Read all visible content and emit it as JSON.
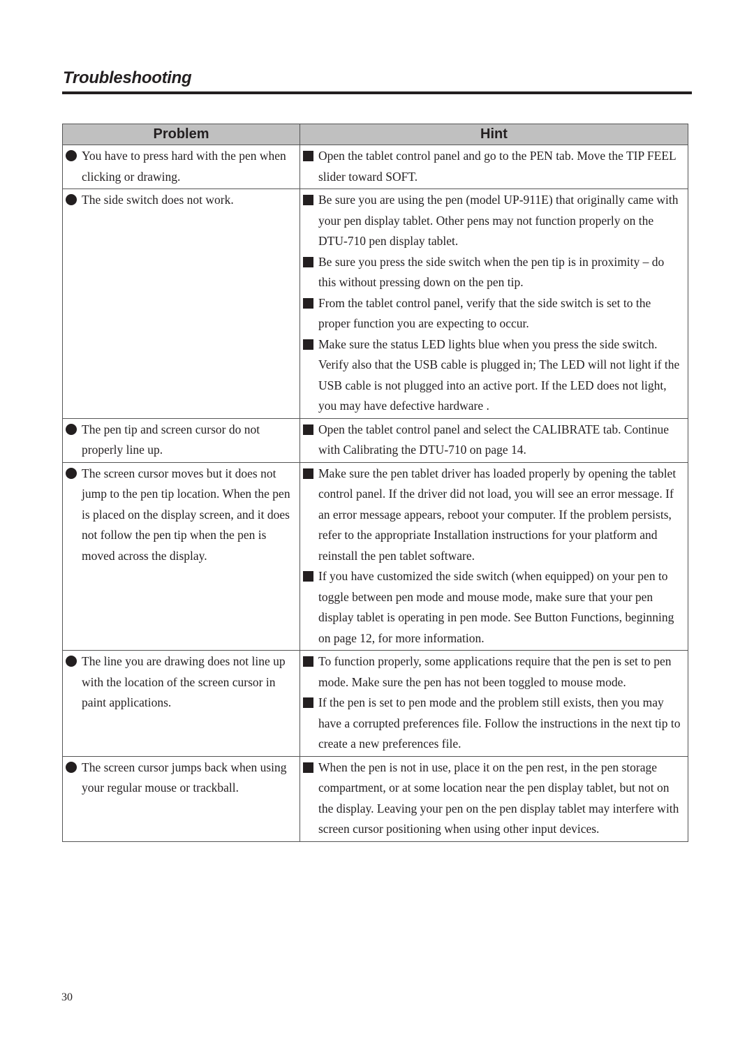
{
  "header": {
    "title": "Troubleshooting"
  },
  "table": {
    "columns": [
      "Problem",
      "Hint"
    ],
    "rows": [
      {
        "problem": "You have to press hard with the pen when clicking or drawing.",
        "hints": [
          "Open the tablet control panel and go to the PEN tab. Move the TIP FEEL slider toward SOFT."
        ]
      },
      {
        "problem": "The side switch does not work.",
        "hints": [
          "Be sure you are using the pen (model UP-911E) that originally came with your pen display tablet. Other pens may not function properly on the DTU-710 pen display tablet.",
          "Be sure you press the side switch when the pen tip is in proximity – do this without pressing down on the pen tip.",
          "From the tablet control panel, verify that the side switch is set to the proper function you are expecting to occur.",
          "Make sure the status LED lights blue when you press the side switch. Verify also that the USB cable is plugged in; The LED will not light if the USB cable is not plugged into an active port. If the LED does not light, you may have defective hardware ."
        ]
      },
      {
        "problem": "The pen tip and screen cursor do not properly line up.",
        "hints": [
          "Open the tablet control panel and select the CALIBRATE tab. Continue with Calibrating the DTU-710 on page 14."
        ]
      },
      {
        "problem": "The screen cursor moves but it does not jump to the pen tip location. When the pen is placed on the display screen, and it does not follow the pen tip when the pen is moved across the display.",
        "hints": [
          "Make sure the pen tablet driver has loaded properly by opening the tablet control panel. If the driver did not load, you will see an error message. If an error message appears, reboot your computer. If the problem persists, refer to the appropriate Installation instructions for your platform and reinstall the pen tablet software.",
          "If you have customized the side switch (when equipped) on your pen to toggle between pen mode and mouse mode, make sure that your pen display tablet is operating in pen mode. See Button Functions, beginning on page 12, for more information."
        ]
      },
      {
        "problem": "The line you are drawing does not line up with the location of the screen cursor in paint applications.",
        "hints": [
          "To function properly, some applications require that the pen is set to pen mode. Make sure the pen has not been toggled to mouse mode.",
          "If the pen is set to pen mode and the problem still exists, then you may have a corrupted preferences file. Follow the instructions in the next tip to create a new preferences file."
        ]
      },
      {
        "problem": "The screen cursor jumps back when using your regular mouse or trackball.",
        "hints": [
          "When the pen is not in use, place it on the pen rest, in the pen storage compartment, or at some location near the pen display tablet, but not on the display. Leaving your pen on the pen display tablet may interfere with screen cursor positioning when using other input devices."
        ]
      }
    ]
  },
  "footer": {
    "page_number": "30"
  }
}
